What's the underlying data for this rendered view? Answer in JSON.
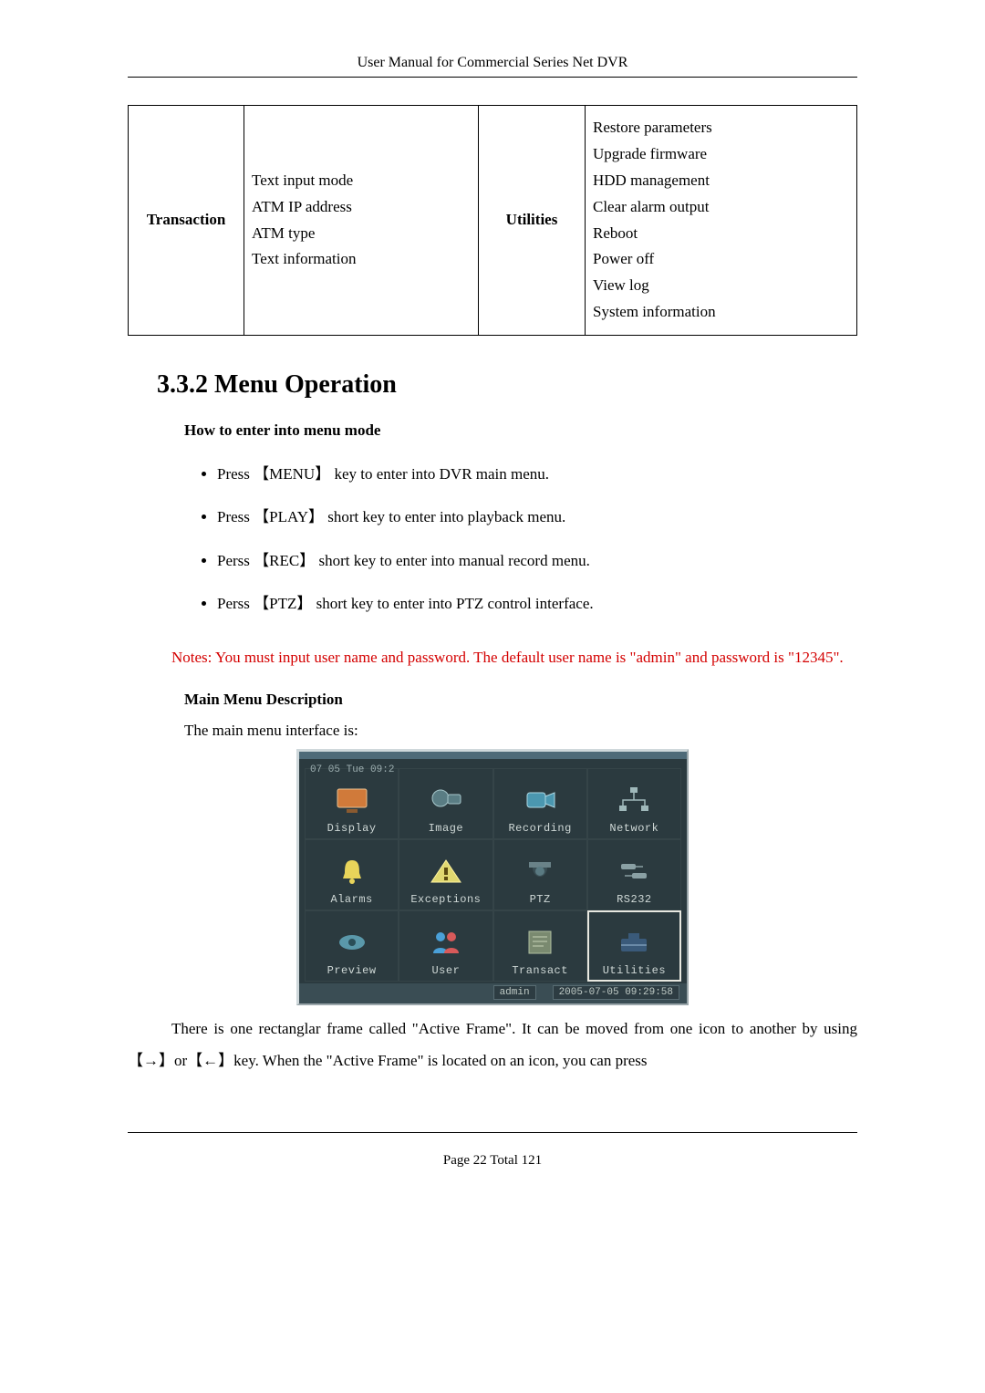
{
  "header": {
    "running_title": "User Manual for Commercial Series Net DVR"
  },
  "table": {
    "col1_header": "Transaction",
    "col1_items": "Text input mode\nATM IP address\nATM type\nText information",
    "col2_header": "Utilities",
    "col2_items": "Restore parameters\nUpgrade firmware\nHDD management\nClear alarm output\nReboot\nPower off\nView log\nSystem information"
  },
  "section": {
    "number_title": "3.3.2  Menu Operation",
    "howto_heading": "How to enter into menu mode",
    "bullets": [
      "Press 【MENU】 key to enter into DVR main menu.",
      "Press 【PLAY】 short key to enter into playback menu.",
      "Perss 【REC】 short key to enter into manual record menu.",
      "Perss 【PTZ】 short key to enter into PTZ control interface."
    ],
    "notes": "Notes: You must input user name and password. The default user name is \"admin\" and password is \"12345\".",
    "mainmenu_heading": "Main Menu Description",
    "mainmenu_intro": "The main menu interface is:",
    "after_shot": "There is one rectanglar frame called \"Active Frame\". It can be moved from one icon to another by using 【→】or【←】key. When the \"Active Frame\" is located on an icon, you can press"
  },
  "dvr_shot": {
    "topleft_date": "07       05  Tue  09:2",
    "items": [
      {
        "label": "Display"
      },
      {
        "label": "Image"
      },
      {
        "label": "Recording"
      },
      {
        "label": "Network"
      },
      {
        "label": "Alarms"
      },
      {
        "label": "Exceptions"
      },
      {
        "label": "PTZ"
      },
      {
        "label": "RS232"
      },
      {
        "label": "Preview"
      },
      {
        "label": "User"
      },
      {
        "label": "Transact"
      },
      {
        "label": "Utilities"
      }
    ],
    "status_user": "admin",
    "status_time": "2005-07-05 09:29:58"
  },
  "footer": {
    "page_label_prefix": "Page ",
    "page_current": "22",
    "page_label_mid": " Total ",
    "page_total": "121"
  }
}
